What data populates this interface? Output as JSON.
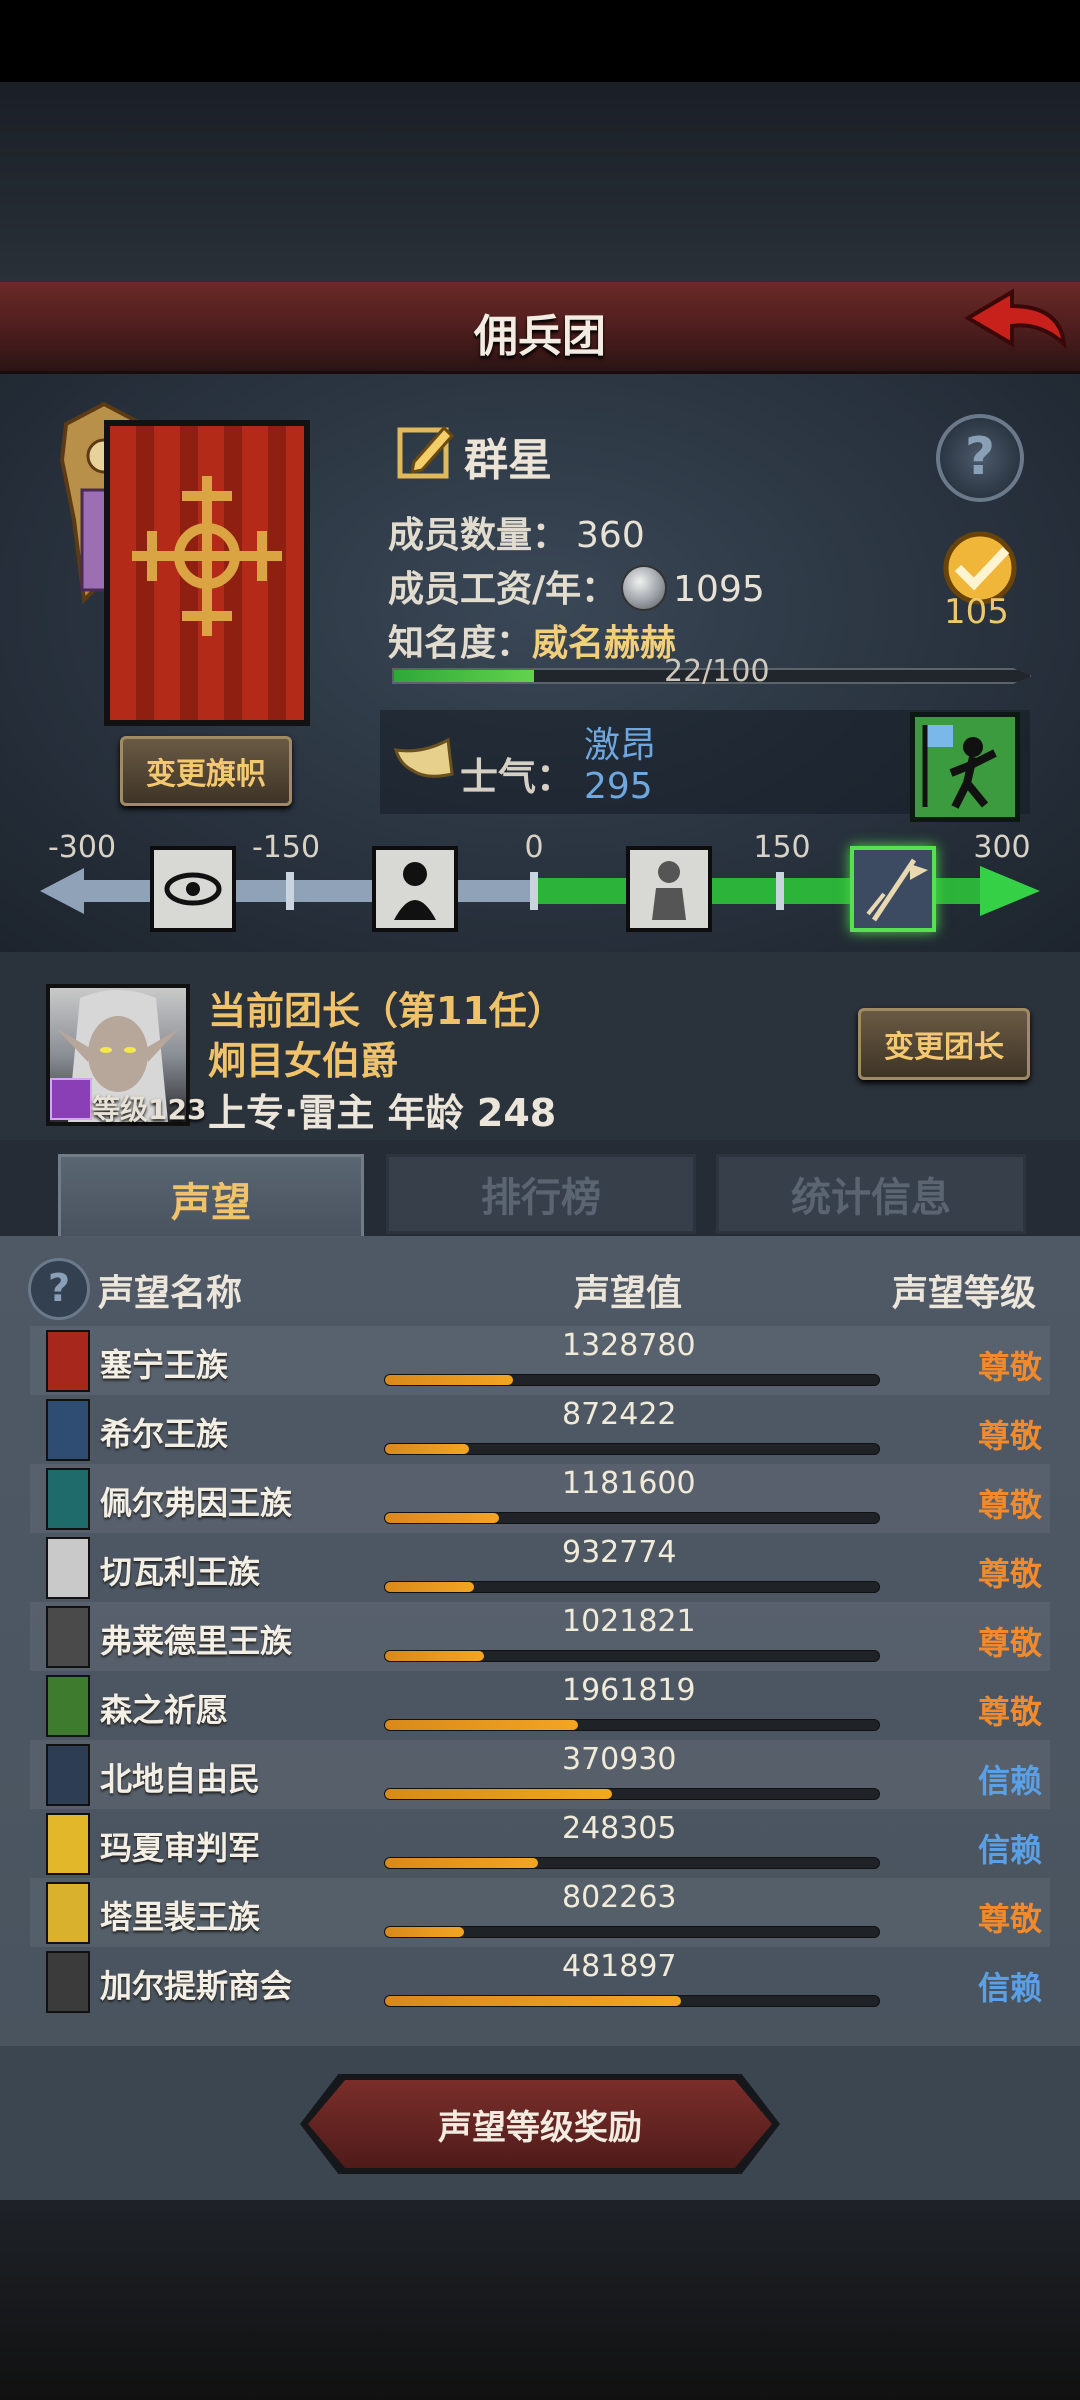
{
  "header": {
    "title": "佣兵团"
  },
  "guild": {
    "name": "群星",
    "members_label": "成员数量：",
    "members_value": "360",
    "wage_label": "成员工资/年：",
    "wage_value": "1095",
    "fame_label": "知名度：",
    "fame_word": "威名赫赫",
    "fame_progress": "22/100",
    "fame_fraction": 0.22,
    "medal_value": "105",
    "change_banner_label": "变更旗帜"
  },
  "morale": {
    "label": "士气：",
    "word": "激昂",
    "value": "295",
    "ticks": [
      "-300",
      "-150",
      "0",
      "150",
      "300"
    ]
  },
  "leader": {
    "line1": "当前团长（第11任）",
    "line2": "炯目女伯爵",
    "line3": "上专·雷主  年龄  248",
    "level": "等级123",
    "change_label": "变更团长"
  },
  "tabs": [
    "声望",
    "排行榜",
    "统计信息"
  ],
  "reputation": {
    "headers": [
      "声望名称",
      "声望值",
      "声望等级"
    ],
    "rows": [
      {
        "name": "塞宁王族",
        "value": "1328780",
        "level": "尊敬",
        "fill": 0.26,
        "color": "#a8271c"
      },
      {
        "name": "希尔王族",
        "value": "872422",
        "level": "尊敬",
        "fill": 0.17,
        "color": "#2f4c73"
      },
      {
        "name": "佩尔弗因王族",
        "value": "1181600",
        "level": "尊敬",
        "fill": 0.23,
        "color": "#1f6a6a"
      },
      {
        "name": "切瓦利王族",
        "value": "932774",
        "level": "尊敬",
        "fill": 0.18,
        "color": "#c9c9c9"
      },
      {
        "name": "弗莱德里王族",
        "value": "1021821",
        "level": "尊敬",
        "fill": 0.2,
        "color": "#4a4a4a"
      },
      {
        "name": "森之祈愿",
        "value": "1961819",
        "level": "尊敬",
        "fill": 0.39,
        "color": "#3f7b2e"
      },
      {
        "name": "北地自由民",
        "value": "370930",
        "level": "信赖",
        "fill": 0.46,
        "color": "#2d3e54"
      },
      {
        "name": "玛夏审判军",
        "value": "248305",
        "level": "信赖",
        "fill": 0.31,
        "color": "#e2b72a"
      },
      {
        "name": "塔里裴王族",
        "value": "802263",
        "level": "尊敬",
        "fill": 0.16,
        "color": "#d9b12c"
      },
      {
        "name": "加尔提斯商会",
        "value": "481897",
        "level": "信赖",
        "fill": 0.6,
        "color": "#3b3b3b"
      }
    ],
    "level_colors": {
      "尊敬": "#f08a2c",
      "信赖": "#5aa0e6"
    }
  },
  "reward_button": "声望等级奖励"
}
